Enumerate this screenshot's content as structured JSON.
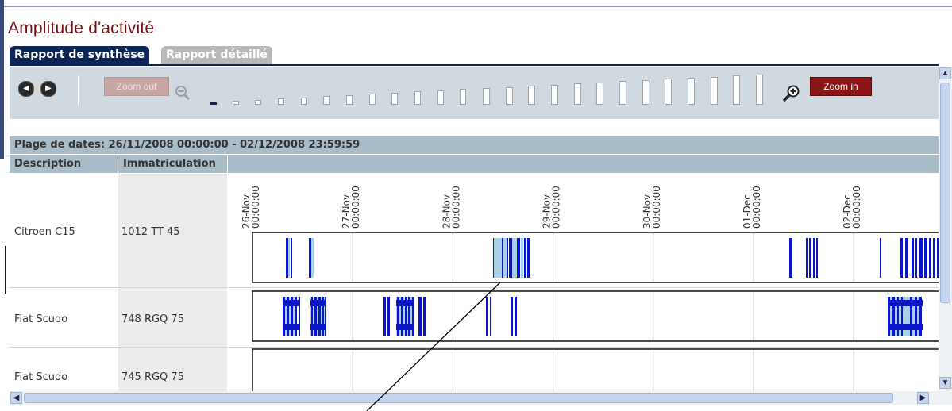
{
  "page": {
    "title": "Amplitude d'activité"
  },
  "tabs": [
    {
      "label": "Rapport de synthèse",
      "active": true
    },
    {
      "label": "Rapport détaillé",
      "active": false
    }
  ],
  "toolbar": {
    "prev_icon": "triangle-left",
    "next_icon": "triangle-right",
    "zoom_out_label": "Zoom out",
    "zoom_in_label": "Zoom in",
    "zoom_levels": 25,
    "selected_zoom_level": 1
  },
  "grid": {
    "date_range": "Plage de dates: 26/11/2008 00:00:00 - 02/12/2008 23:59:59",
    "columns": [
      "Description",
      "Immatriculation"
    ],
    "timeline_ticks": [
      {
        "date": "26-Nov",
        "time": "00:00:00"
      },
      {
        "date": "27-Nov",
        "time": "00:00:00"
      },
      {
        "date": "28-Nov",
        "time": "00:00:00"
      },
      {
        "date": "29-Nov",
        "time": "00:00:00"
      },
      {
        "date": "30-Nov",
        "time": "00:00:00"
      },
      {
        "date": "01-Dec",
        "time": "00:00:00"
      },
      {
        "date": "02-Dec",
        "time": "00:00:00"
      }
    ],
    "rows": [
      {
        "description": "Citroen C15",
        "registration": "1012 TT 45"
      },
      {
        "description": "Fiat Scudo",
        "registration": "748 RGQ 75"
      },
      {
        "description": "Fiat Scudo",
        "registration": "745 RGQ 75"
      }
    ]
  },
  "colors": {
    "title": "#7a0f12",
    "tab_active": "#0c2456",
    "activity_dark": "#0a16c8",
    "activity_light": "#a8d2e6",
    "header_bg": "#a9bcc9"
  }
}
